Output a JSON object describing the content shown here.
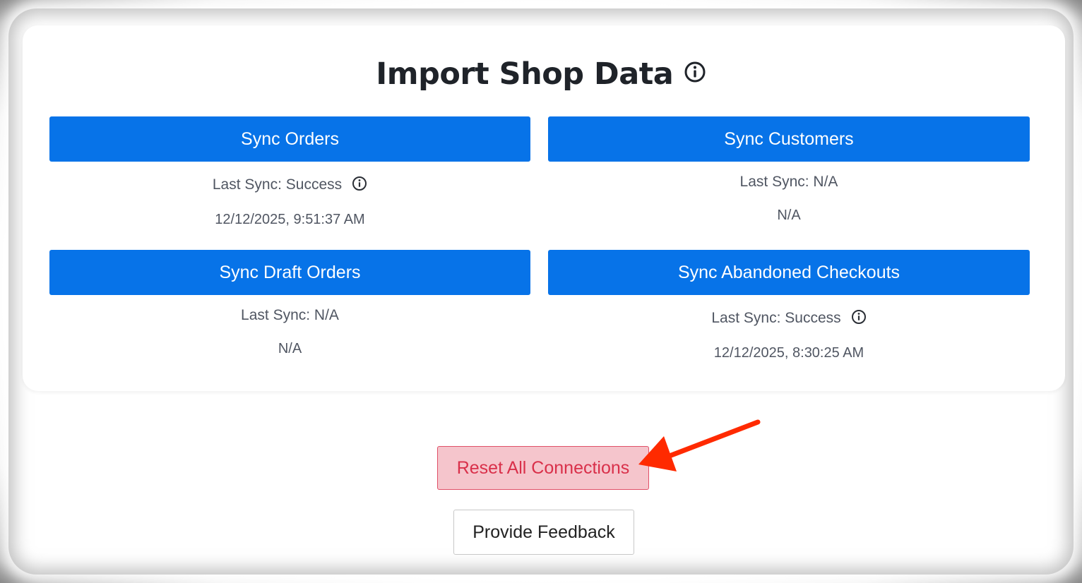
{
  "page": {
    "title": "Import Shop Data",
    "title_icon": "info-circle-icon"
  },
  "sync_cards": [
    {
      "button_label": "Sync Orders",
      "status": "Last Sync: Success",
      "has_info_icon": true,
      "date": "12/12/2025, 9:51:37 AM"
    },
    {
      "button_label": "Sync Customers",
      "status": "Last Sync: N/A",
      "has_info_icon": false,
      "date": "N/A"
    },
    {
      "button_label": "Sync Draft Orders",
      "status": "Last Sync: N/A",
      "has_info_icon": false,
      "date": "N/A"
    },
    {
      "button_label": "Sync Abandoned Checkouts",
      "status": "Last Sync: Success",
      "has_info_icon": true,
      "date": "12/12/2025, 8:30:25 AM"
    }
  ],
  "actions": {
    "reset_label": "Reset All Connections",
    "feedback_label": "Provide Feedback"
  },
  "annotation": {
    "arrow_icon": "red-arrow-pointer-icon",
    "arrow_color": "#ff2a00"
  },
  "colors": {
    "primary_button": "#0773e8",
    "reset_bg": "#f5c5cc",
    "reset_text": "#d9304a"
  }
}
